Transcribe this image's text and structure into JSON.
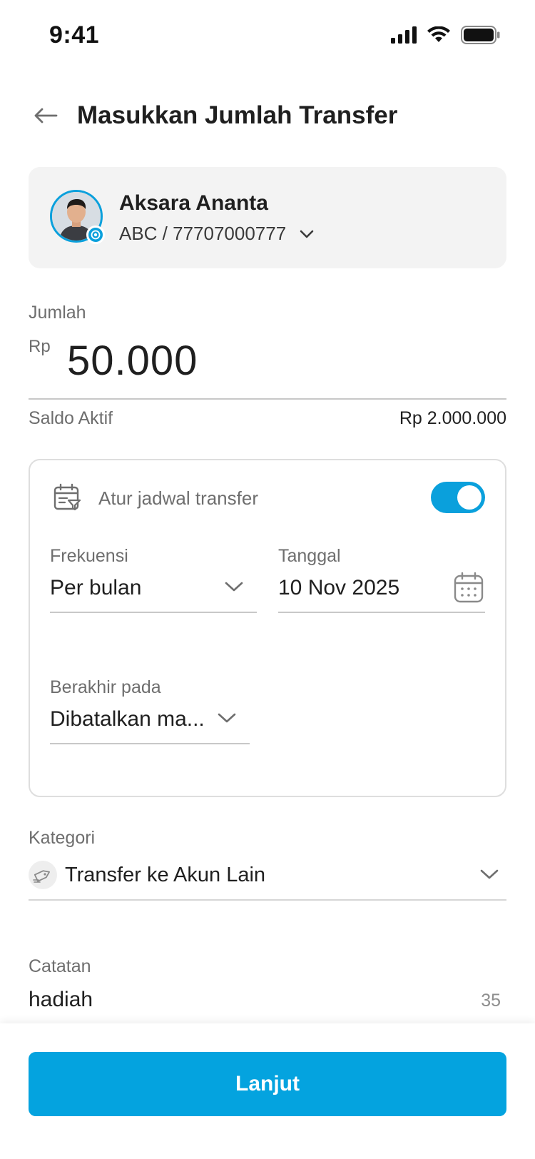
{
  "status_bar": {
    "time": "9:41"
  },
  "header": {
    "title": "Masukkan Jumlah Transfer"
  },
  "recipient": {
    "name": "Aksara Ananta",
    "account": "ABC / 77707000777"
  },
  "amount": {
    "label": "Jumlah",
    "currency": "Rp",
    "value": "50.000"
  },
  "balance": {
    "label": "Saldo Aktif",
    "value": "Rp 2.000.000"
  },
  "schedule": {
    "label": "Atur jadwal transfer",
    "enabled": true,
    "frequency": {
      "label": "Frekuensi",
      "value": "Per bulan"
    },
    "date": {
      "label": "Tanggal",
      "value": "10 Nov 2025"
    },
    "ends_on": {
      "label": "Berakhir pada",
      "value": "Dibatalkan ma..."
    }
  },
  "category": {
    "label": "Kategori",
    "value": "Transfer ke Akun Lain"
  },
  "notes": {
    "label": "Catatan",
    "value": "hadiah",
    "remaining": "35"
  },
  "footer": {
    "next_label": "Lanjut"
  },
  "colors": {
    "accent": "#04a3df",
    "text": "#1f1f1f",
    "muted": "#6e6e6e"
  }
}
